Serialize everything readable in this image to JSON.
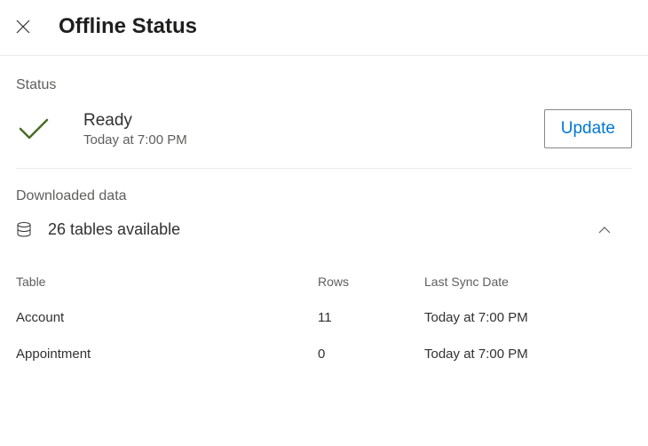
{
  "header": {
    "title": "Offline Status"
  },
  "status_section": {
    "label": "Status",
    "status_title": "Ready",
    "status_timestamp": "Today at 7:00 PM",
    "update_button": "Update"
  },
  "downloaded_section": {
    "label": "Downloaded data",
    "tables_available": "26 tables available"
  },
  "table": {
    "headers": {
      "table": "Table",
      "rows": "Rows",
      "sync": "Last Sync Date"
    },
    "rows": [
      {
        "name": "Account",
        "count": "11",
        "sync": "Today at 7:00 PM"
      },
      {
        "name": "Appointment",
        "count": "0",
        "sync": "Today at 7:00 PM"
      }
    ]
  },
  "colors": {
    "checkmark": "#486e26",
    "link": "#0078d4"
  }
}
